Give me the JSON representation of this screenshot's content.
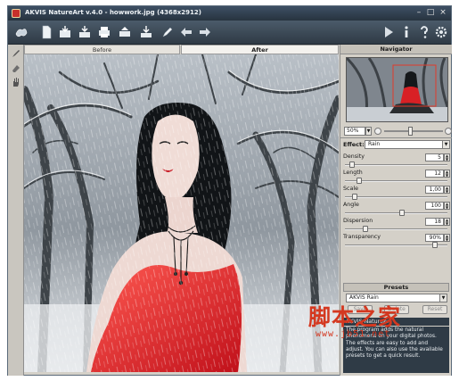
{
  "window": {
    "title": "AKVIS NatureArt v.4.0 - howwork.jpg (4368x2912)"
  },
  "toolbar": {
    "left_icons": [
      "app-logo-icon",
      "new-icon",
      "open-icon",
      "save-icon",
      "print-icon",
      "share-icon",
      "batch-icon",
      "brush-icon",
      "undo-icon",
      "redo-icon"
    ],
    "right_icons": [
      "run-icon",
      "info-icon",
      "help-icon",
      "settings-icon"
    ]
  },
  "tabs": {
    "before": "Before",
    "after": "After"
  },
  "navigator": {
    "title": "Navigator",
    "zoom": "50%"
  },
  "effect": {
    "label": "Effect:",
    "value": "Rain"
  },
  "params": [
    {
      "label": "Density",
      "value": "5",
      "level": 0.05
    },
    {
      "label": "Length",
      "value": "12",
      "level": 0.12
    },
    {
      "label": "Scale",
      "value": "1,00",
      "level": 0.07
    },
    {
      "label": "Angle",
      "value": "100",
      "level": 0.56
    },
    {
      "label": "Dispersion",
      "value": "18",
      "level": 0.18
    },
    {
      "label": "Transparency",
      "value": "90%",
      "level": 0.9
    }
  ],
  "presets": {
    "title": "Presets",
    "selected": "AKVIS Rain",
    "save": "Save",
    "delete": "Delete",
    "reset": "Reset"
  },
  "help": {
    "title": "AKVIS NatureArt",
    "text": "The program adds the natural phenomena on your digital photos. The effects are easy to add and adjust. You can also use the available presets to get a quick result."
  },
  "watermark": {
    "cn": "脚本之家",
    "url": "www.jb51.net"
  }
}
